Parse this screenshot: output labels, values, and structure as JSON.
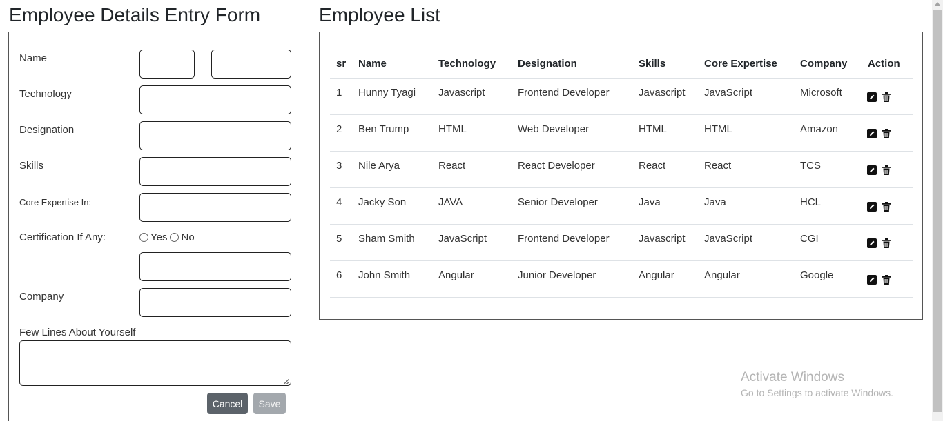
{
  "form": {
    "title": "Employee Details Entry Form",
    "labels": {
      "name": "Name",
      "technology": "Technology",
      "designation": "Designation",
      "skills": "Skills",
      "core_expertise": "Core Expertise In:",
      "certification": "Certification If Any:",
      "company": "Company",
      "about": "Few Lines About Yourself"
    },
    "radio": {
      "yes": "Yes",
      "no": "No"
    },
    "buttons": {
      "cancel": "Cancel",
      "save": "Save"
    }
  },
  "list": {
    "title": "Employee List",
    "columns": [
      "sr",
      "Name",
      "Technology",
      "Designation",
      "Skills",
      "Core Expertise",
      "Company",
      "Action"
    ],
    "rows": [
      [
        "1",
        "Hunny Tyagi",
        "Javascript",
        "Frontend Developer",
        "Javascript",
        "JavaScript",
        "Microsoft"
      ],
      [
        "2",
        "Ben Trump",
        "HTML",
        "Web Developer",
        "HTML",
        "HTML",
        "Amazon"
      ],
      [
        "3",
        "Nile Arya",
        "React",
        "React Developer",
        "React",
        "React",
        "TCS"
      ],
      [
        "4",
        "Jacky Son",
        "JAVA",
        "Senior Developer",
        "Java",
        "Java",
        "HCL"
      ],
      [
        "5",
        "Sham Smith",
        "JavaScript",
        "Frontend Developer",
        "Javascript",
        "JavaScript",
        "CGI"
      ],
      [
        "6",
        "John Smith",
        "Angular",
        "Junior Developer",
        "Angular",
        "Angular",
        "Google"
      ]
    ],
    "action_icons": [
      "edit-icon",
      "trash-icon"
    ]
  },
  "watermark": {
    "title": "Activate Windows",
    "subtitle": "Go to Settings to activate Windows."
  }
}
